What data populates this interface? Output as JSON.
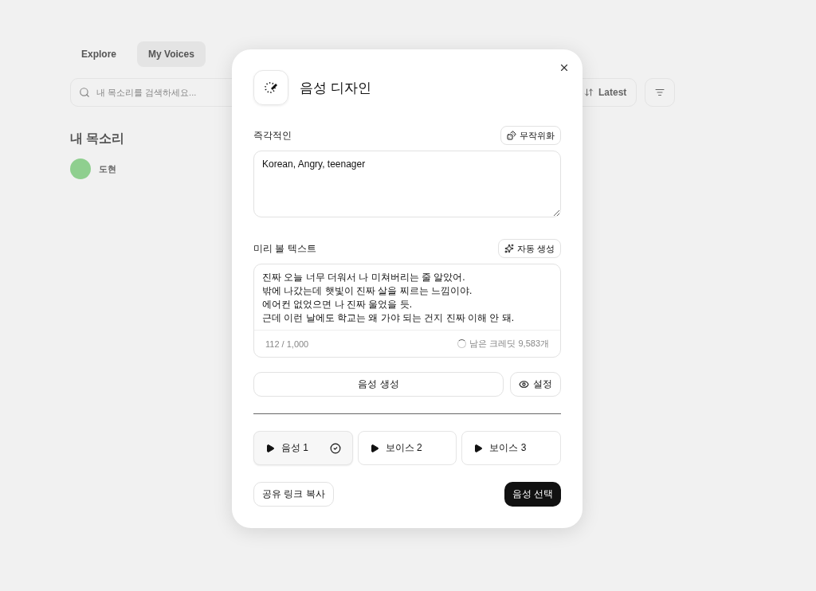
{
  "background": {
    "nav": [
      {
        "label": "Explore",
        "selected": false
      },
      {
        "label": "My Voices",
        "selected": true
      }
    ],
    "search": {
      "placeholder": "내 목소리를 검색하세요..."
    },
    "sort_button": "Latest",
    "section_title": "내 목소리",
    "voice_name": "도현"
  },
  "dialog": {
    "title": "음성 디자인",
    "prompt": {
      "label": "즉각적인",
      "randomize_button": "무작위화",
      "value": "Korean, Angry, teenager"
    },
    "preview": {
      "label": "미리 볼 텍스트",
      "auto_button": "자동 생성",
      "lines": [
        "진짜 오늘 너무 더워서 나 미쳐버리는 줄 알았어.",
        "밖에 나갔는데 햇빛이 진짜 살을 찌르는 느낌이야.",
        "에어컨 없었으면 나 진짜 울었을 듯.",
        "근데 이런 날에도 학교는 왜 가야 되는 건지 진짜 이해 안 돼."
      ],
      "count": "112 / 1,000",
      "credits": "남은 크레딧 9,583개"
    },
    "generate_button": "음성 생성",
    "settings_button": "설정",
    "voices": [
      {
        "label": "음성 1",
        "selected": true
      },
      {
        "label": "보이스 2",
        "selected": false
      },
      {
        "label": "보이스 3",
        "selected": false
      }
    ],
    "share_button": "공유 링크 복사",
    "select_button": "음성 선택"
  }
}
